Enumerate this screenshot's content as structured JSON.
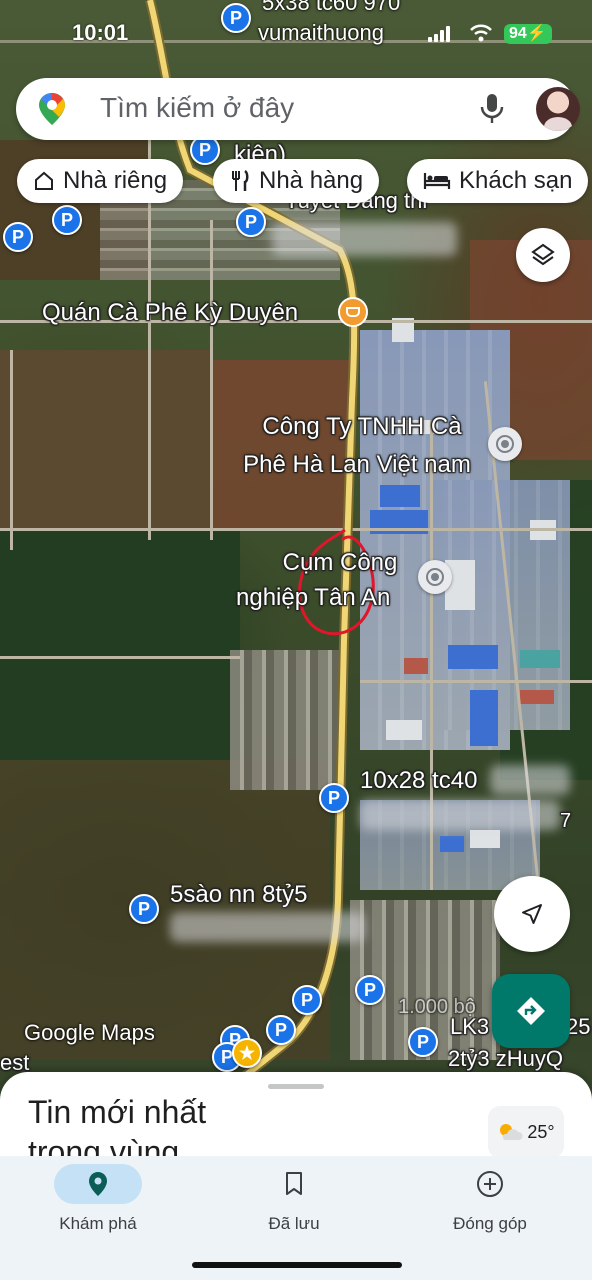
{
  "status_bar": {
    "time": "10:01",
    "carrier": "vumaithuong",
    "battery": "94"
  },
  "search": {
    "placeholder": "Tìm kiếm ở đây"
  },
  "chips": [
    {
      "label": "Nhà riêng",
      "icon": "home-icon"
    },
    {
      "label": "Nhà hàng",
      "icon": "restaurant-icon"
    },
    {
      "label": "Khách sạn",
      "icon": "hotel-icon"
    }
  ],
  "map": {
    "labels": {
      "top": "5x38 tc60 970",
      "kien": "kiện)",
      "tuyet": "Tuyet Dang thi",
      "cafe": "Quán Cà Phê Kỳ Duyên",
      "company_line1": "Công Ty TNHH Cà",
      "company_line2": "Phê Hà Lan Việt nam",
      "cluster_line1": "Cụm Công",
      "cluster_line2": "nghiệp Tân An",
      "lot1": "10x28 tc40",
      "lot2": "5sào nn 8tỷ5",
      "price": "1.000 bộ",
      "lk": "LK3",
      "lk_price": "2tỷ3 zHuyQ",
      "est": "est",
      "suffix_25": "25",
      "suffix_7": "7"
    },
    "logo": "Google Maps"
  },
  "sheet": {
    "title": "Tin mới nhất trong vùng",
    "temperature": "25°"
  },
  "nav": [
    {
      "label": "Khám phá",
      "icon": "explore-pin-icon",
      "active": true
    },
    {
      "label": "Đã lưu",
      "icon": "bookmark-icon",
      "active": false
    },
    {
      "label": "Đóng góp",
      "icon": "add-circle-icon",
      "active": false
    }
  ],
  "colors": {
    "accent": "#1a73e8",
    "directions_fab": "#00796b",
    "nav_active": "#c5e1f5",
    "main_road": "#e8cf73"
  }
}
